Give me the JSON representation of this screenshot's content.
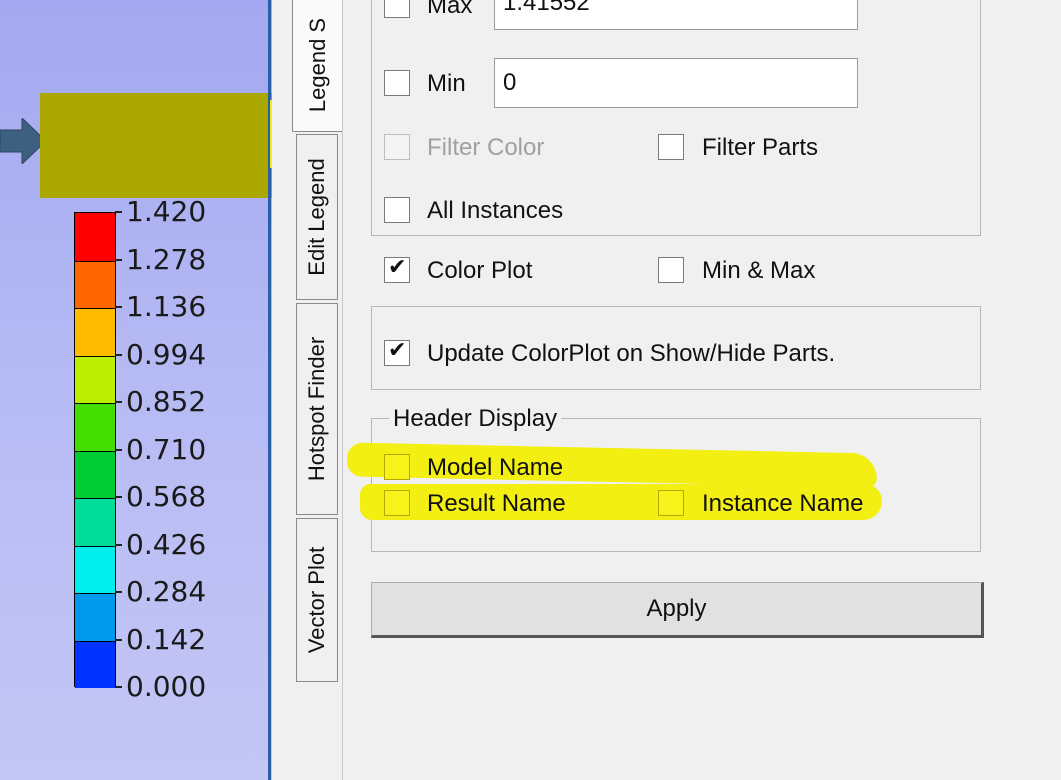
{
  "legend": {
    "values": [
      "1.420",
      "1.278",
      "1.136",
      "0.994",
      "0.852",
      "0.710",
      "0.568",
      "0.426",
      "0.284",
      "0.142",
      "0.000"
    ],
    "colors": [
      "#ff0000",
      "#ff6600",
      "#ffbb00",
      "#bbee00",
      "#44dd00",
      "#00cc33",
      "#00dd99",
      "#00eeee",
      "#0099ee",
      "#0033ff"
    ]
  },
  "tabs": [
    "Legend S",
    "Edit Legend",
    "Hotspot Finder",
    "Vector Plot"
  ],
  "form": {
    "max_label": "Max",
    "max_value": "1.41552",
    "min_label": "Min",
    "min_value": "0",
    "filter_color_label": "Filter Color",
    "filter_parts_label": "Filter Parts",
    "all_instances_label": "All Instances",
    "color_plot_label": "Color Plot",
    "color_plot_checked": true,
    "min_max_label": "Min & Max",
    "update_label": "Update ColorPlot on Show/Hide Parts.",
    "update_checked": true,
    "header_group_title": "Header Display",
    "model_name_label": "Model Name",
    "result_name_label": "Result Name",
    "instance_name_label": "Instance Name",
    "apply_label": "Apply"
  },
  "icons": {
    "check": "✔"
  }
}
